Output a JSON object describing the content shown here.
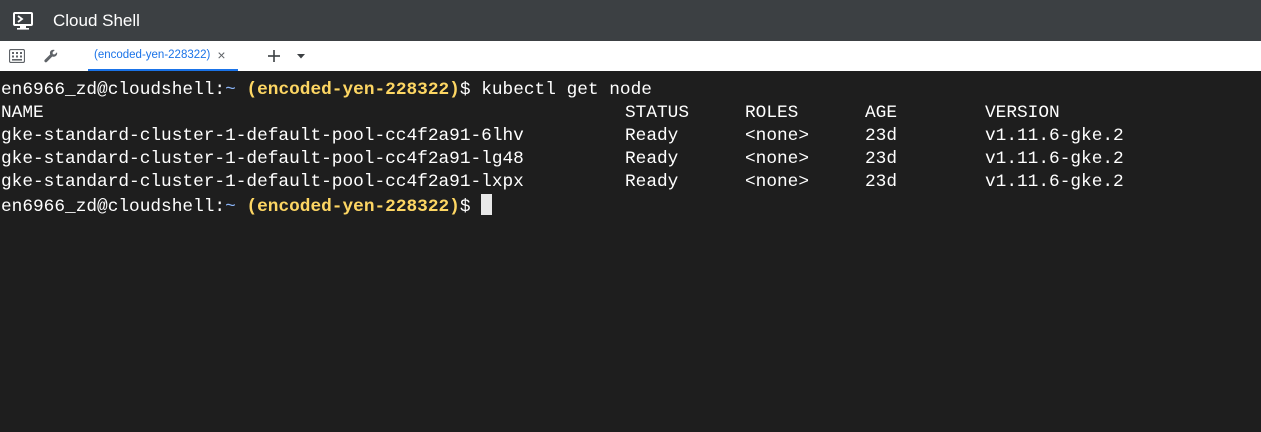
{
  "window": {
    "title": "Cloud Shell",
    "icon": "cloud-shell-terminal-icon"
  },
  "toolbar": {
    "keyboard_icon": "keyboard-icon",
    "settings_icon": "wrench-icon",
    "add_tab_icon": "plus-icon",
    "tab_menu_icon": "caret-down-icon"
  },
  "tabs": [
    {
      "label": "(encoded-yen-228322)",
      "close_glyph": "×",
      "active": true
    }
  ],
  "terminal": {
    "prompt": {
      "user_host": "en6966_zd@cloudshell:",
      "path": "~",
      "project": "(encoded-yen-228322)",
      "symbol": "$"
    },
    "command": "kubectl get node",
    "table": {
      "headers": [
        "NAME",
        "STATUS",
        "ROLES",
        "AGE",
        "VERSION"
      ],
      "rows": [
        [
          "gke-standard-cluster-1-default-pool-cc4f2a91-6lhv",
          "Ready",
          "<none>",
          "23d",
          "v1.11.6-gke.2"
        ],
        [
          "gke-standard-cluster-1-default-pool-cc4f2a91-lg48",
          "Ready",
          "<none>",
          "23d",
          "v1.11.6-gke.2"
        ],
        [
          "gke-standard-cluster-1-default-pool-cc4f2a91-lxpx",
          "Ready",
          "<none>",
          "23d",
          "v1.11.6-gke.2"
        ]
      ]
    },
    "colors": {
      "background": "#1e1e1e",
      "text": "#ffffff",
      "project": "#fdd663",
      "path": "#8ab4f8"
    }
  }
}
